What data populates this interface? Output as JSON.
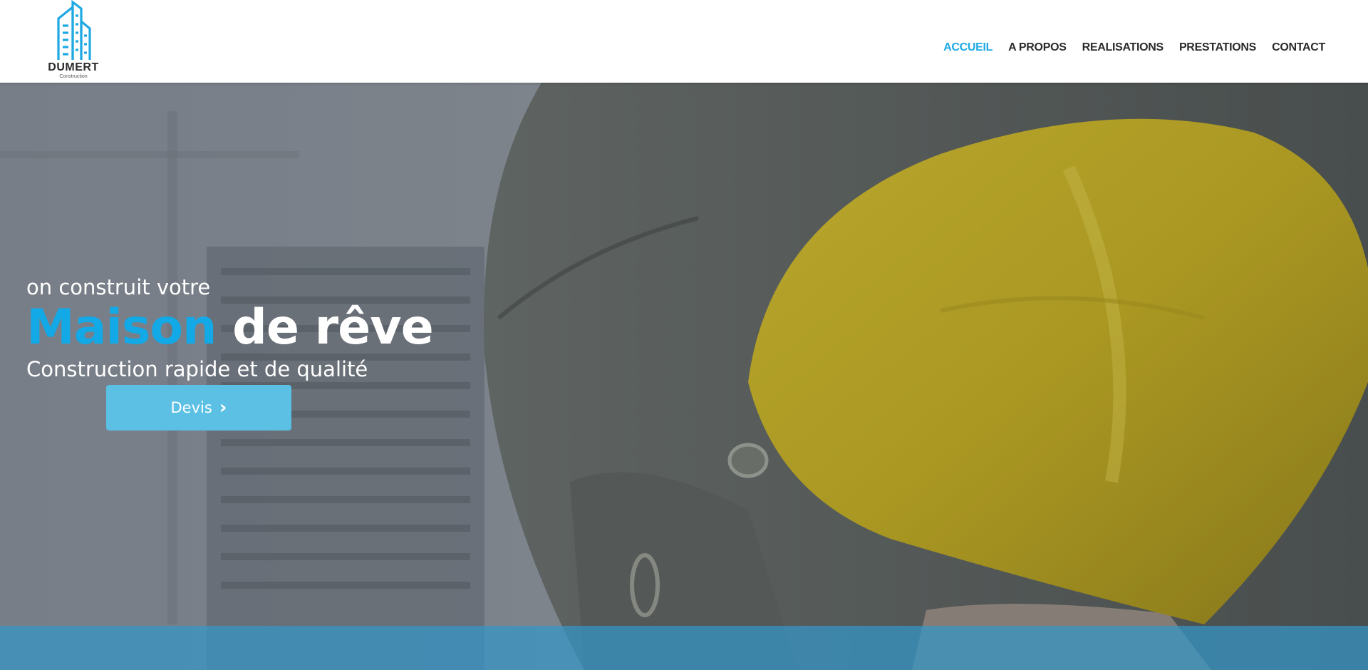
{
  "brand": {
    "name": "DUMERT",
    "sub": "Construction",
    "color": "#1fa9e3",
    "logo_icon": "building-icon"
  },
  "nav": {
    "items": [
      {
        "label": "ACCUEIL",
        "active": true
      },
      {
        "label": "A PROPOS",
        "active": false
      },
      {
        "label": "REALISATIONS",
        "active": false
      },
      {
        "label": "PRESTATIONS",
        "active": false
      },
      {
        "label": "CONTACT",
        "active": false
      }
    ]
  },
  "hero": {
    "kicker": "on construit votre",
    "headline_accent": "Maison",
    "headline_rest": "de rêve",
    "subtitle": "Construction rapide et de qualité",
    "button_label": "Devis",
    "button_icon": "chevron-right-icon",
    "accent_color": "#13a8e6",
    "button_color": "#5bc0e3"
  }
}
